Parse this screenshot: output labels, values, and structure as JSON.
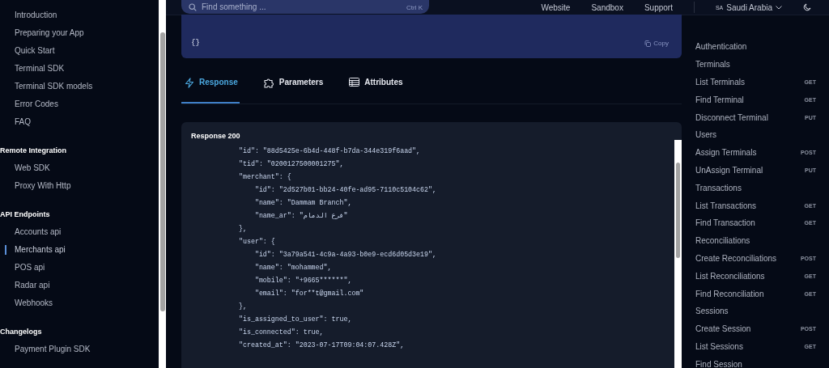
{
  "sidebar": {
    "sections": [
      {
        "items": [
          {
            "label": "Introduction",
            "selected": false
          },
          {
            "label": "Preparing your App",
            "selected": false
          },
          {
            "label": "Quick Start",
            "selected": false
          },
          {
            "label": "Terminal SDK",
            "selected": false
          },
          {
            "label": "Terminal SDK models",
            "selected": false
          },
          {
            "label": "Error Codes",
            "selected": false
          },
          {
            "label": "FAQ",
            "selected": false
          }
        ]
      },
      {
        "title": "Remote Integration",
        "items": [
          {
            "label": "Web SDK",
            "selected": false
          },
          {
            "label": "Proxy With Http",
            "selected": false
          }
        ]
      },
      {
        "title": "API Endpoints",
        "items": [
          {
            "label": "Accounts api",
            "selected": false
          },
          {
            "label": "Merchants api",
            "selected": true
          },
          {
            "label": "POS api",
            "selected": false
          },
          {
            "label": "Radar api",
            "selected": false
          },
          {
            "label": "Webhooks",
            "selected": false
          }
        ]
      },
      {
        "title": "Changelogs",
        "items": [
          {
            "label": "Payment Plugin SDK",
            "selected": false
          }
        ]
      }
    ]
  },
  "header": {
    "search": {
      "placeholder": "Find something ...",
      "shortcut": "Ctrl K"
    },
    "links": [
      "Website",
      "Sandbox",
      "Support"
    ],
    "region": {
      "code": "SA",
      "label": "Saudi Arabia"
    }
  },
  "request": {
    "body": "{}",
    "copy_label": "Copy"
  },
  "tabs": [
    {
      "label": "Response",
      "kind": "bolt",
      "selected": true
    },
    {
      "label": "Parameters",
      "kind": "puzzle",
      "selected": false
    },
    {
      "label": "Attributes",
      "kind": "table",
      "selected": false
    }
  ],
  "response": {
    "title": "Response 200",
    "lines": [
      "\"id\": \"88d5425e-6b4d-448f-b7da-344e319f6aad\",",
      "\"tid\": \"0200127500001275\",",
      "\"merchant\": {",
      "    \"id\": \"2d527b01-bb24-40fe-ad95-7110c5104c62\",",
      "    \"name\": \"Dammam Branch\",",
      "    \"name_ar\": \"فرع الدمام\"",
      "},",
      "\"user\": {",
      "    \"id\": \"3a79a541-4c9a-4a93-b0e9-ecd6d05d3e19\",",
      "    \"name\": \"mohammed\",",
      "    \"mobile\": \"+9665******\",",
      "    \"email\": \"for**t@gmail.com\"",
      "},",
      "\"is_assigned_to_user\": true,",
      "\"is_connected\": true,",
      "\"created_at\": \"2023-07-17T09:04:07.428Z\","
    ]
  },
  "right_nav": [
    {
      "label": "Authentication"
    },
    {
      "label": "Terminals"
    },
    {
      "label": "List Terminals",
      "method": "GET"
    },
    {
      "label": "Find Terminal",
      "method": "GET"
    },
    {
      "label": "Disconnect Terminal",
      "method": "PUT"
    },
    {
      "label": "Users"
    },
    {
      "label": "Assign Terminals",
      "method": "POST"
    },
    {
      "label": "UnAssign Terminal",
      "method": "PUT"
    },
    {
      "label": "Transactions"
    },
    {
      "label": "List Transactions",
      "method": "GET"
    },
    {
      "label": "Find Transaction",
      "method": "GET"
    },
    {
      "label": "Reconciliations"
    },
    {
      "label": "Create Reconciliations",
      "method": "POST"
    },
    {
      "label": "List Reconciliations",
      "method": "GET"
    },
    {
      "label": "Find Reconciliation",
      "method": "GET"
    },
    {
      "label": "Sessions"
    },
    {
      "label": "Create Session",
      "method": "POST"
    },
    {
      "label": "List Sessions",
      "method": "GET"
    },
    {
      "label": "Find Session"
    }
  ]
}
